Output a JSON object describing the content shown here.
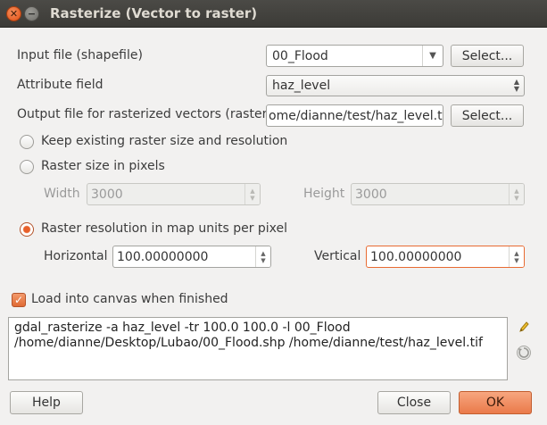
{
  "window": {
    "title": "Rasterize (Vector to raster)"
  },
  "input_file": {
    "label": "Input file (shapefile)",
    "value": "00_Flood",
    "select_label": "Select..."
  },
  "attribute_field": {
    "label": "Attribute field",
    "value": "haz_level"
  },
  "output_file": {
    "label": "Output file for rasterized vectors (raster)",
    "value": "ome/dianne/test/haz_level.tif",
    "select_label": "Select..."
  },
  "options": {
    "keep_size": {
      "label": "Keep existing raster size and resolution",
      "selected": false
    },
    "size_pixels": {
      "label": "Raster size in pixels",
      "selected": false
    },
    "width": {
      "label": "Width",
      "value": "3000"
    },
    "height": {
      "label": "Height",
      "value": "3000"
    },
    "resolution": {
      "label": "Raster resolution in map units per pixel",
      "selected": true
    },
    "horizontal": {
      "label": "Horizontal",
      "value": "100.00000000"
    },
    "vertical": {
      "label": "Vertical",
      "value": "100.00000000"
    }
  },
  "load_canvas": {
    "label": "Load into canvas when finished",
    "checked": true
  },
  "command": {
    "text": "gdal_rasterize -a haz_level -tr 100.0 100.0 -l 00_Flood\n/home/dianne/Desktop/Lubao/00_Flood.shp /home/dianne/test/haz_level.tif"
  },
  "buttons": {
    "help": "Help",
    "close": "Close",
    "ok": "OK"
  },
  "icons": {
    "edit": "pencil-icon",
    "reset": "reset-icon"
  },
  "colors": {
    "accent": "#e8602a",
    "titlebar": "#3c3b37"
  }
}
